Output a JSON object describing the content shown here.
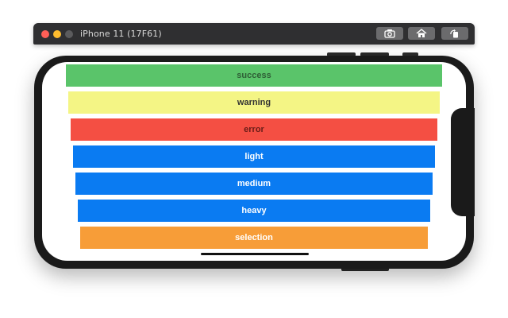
{
  "window": {
    "title": "iPhone 11 (17F61)",
    "toolbar": {
      "screenshot_icon": "camera-icon",
      "home_icon": "home-icon",
      "rotate_icon": "rotate-icon"
    }
  },
  "app": {
    "buttons": [
      {
        "label": "success",
        "color": "#5ac46a",
        "text_color": "#2f5f36"
      },
      {
        "label": "warning",
        "color": "#f4f585",
        "text_color": "#333333"
      },
      {
        "label": "error",
        "color": "#f44f43",
        "text_color": "#6a1d18"
      },
      {
        "label": "light",
        "color": "#0a7bf2",
        "text_color": "#ffffff"
      },
      {
        "label": "medium",
        "color": "#0a7bf2",
        "text_color": "#ffffff"
      },
      {
        "label": "heavy",
        "color": "#0a7bf2",
        "text_color": "#ffffff"
      },
      {
        "label": "selection",
        "color": "#f79d38",
        "text_color": "#ffffff"
      }
    ]
  }
}
